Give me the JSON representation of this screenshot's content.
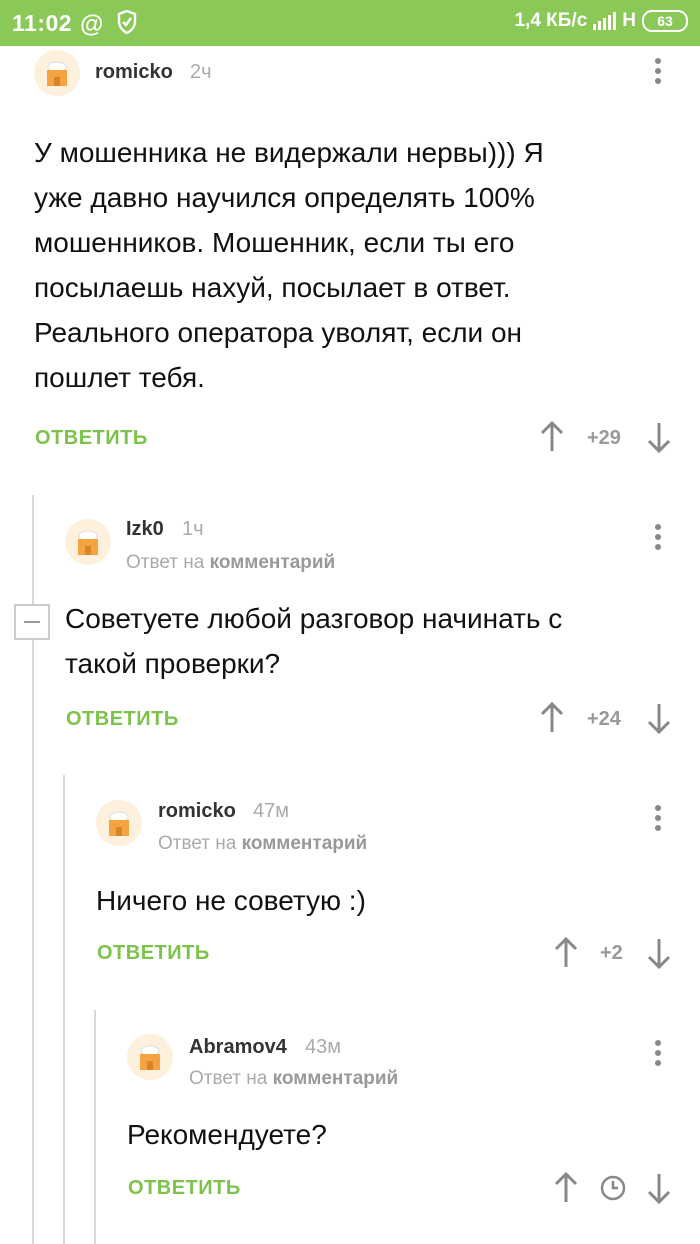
{
  "status_bar": {
    "time": "11:02",
    "net_speed": "1,4 КБ/с",
    "network_type": "H",
    "battery": "63",
    "icons": [
      "at-icon",
      "shield-icon",
      "signal-icon",
      "battery-icon"
    ]
  },
  "comments": [
    {
      "author": "romicko",
      "time": "2ч",
      "reply_to": null,
      "lines": [
        "У мошенника не видержали нервы))) Я",
        "уже давно научился определять 100%",
        "мошенников. Мошенник, если ты его",
        "посылаешь нахуй, посылает в ответ.",
        "Реального оператора уволят, если он",
        "пошлет тебя."
      ],
      "reply_label": "ОТВЕТИТЬ",
      "rating": "+29"
    },
    {
      "author": "Izk0",
      "time": "1ч",
      "reply_to_prefix": "Ответ на",
      "reply_to_link": "комментарий",
      "lines": [
        "Советуете любой разговор начинать с",
        "такой проверки?"
      ],
      "reply_label": "ОТВЕТИТЬ",
      "rating": "+24"
    },
    {
      "author": "romicko",
      "time": "47м",
      "reply_to_prefix": "Ответ на",
      "reply_to_link": "комментарий",
      "lines": [
        "Ничего не советую :)"
      ],
      "reply_label": "ОТВЕТИТЬ",
      "rating": "+2"
    },
    {
      "author": "Abramov4",
      "time": "43м",
      "reply_to_prefix": "Ответ на",
      "reply_to_link": "комментарий",
      "lines": [
        "Рекомендуете?"
      ],
      "reply_label": "ОТВЕТИТЬ",
      "rating_icon": "clock-icon"
    }
  ],
  "colors": {
    "status_bar": "#8ac858",
    "accent_green": "#7dc34b",
    "muted": "#aaaaaa"
  }
}
